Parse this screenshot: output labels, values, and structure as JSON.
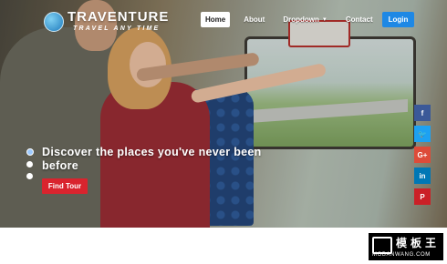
{
  "brand": {
    "title": "TRAVENTURE",
    "tagline": "TRAVEL ANY TIME"
  },
  "nav": {
    "items": [
      {
        "label": "Home",
        "active": true
      },
      {
        "label": "About",
        "active": false
      },
      {
        "label": "Dropdown",
        "active": false,
        "has_caret": true
      },
      {
        "label": "Contact",
        "active": false
      }
    ],
    "login_label": "Login"
  },
  "hero": {
    "headline": "Discover the places you've never been before",
    "cta_label": "Find Tour",
    "slides": {
      "count": 3,
      "active_index": 0
    }
  },
  "social": [
    {
      "icon": "facebook-icon",
      "glyph": "f",
      "color": "#3b5998"
    },
    {
      "icon": "twitter-icon",
      "glyph": "🐦",
      "color": "#1da1f2"
    },
    {
      "icon": "google-plus-icon",
      "glyph": "G+",
      "color": "#dd4b39"
    },
    {
      "icon": "linkedin-icon",
      "glyph": "in",
      "color": "#0077b5"
    },
    {
      "icon": "pinterest-icon",
      "glyph": "P",
      "color": "#cb2027"
    }
  ],
  "colors": {
    "accent_blue": "#1e88e5",
    "cta_red": "#d9242e"
  },
  "watermark": {
    "cn": "模板王",
    "url": "MOBANWANG.COM"
  }
}
